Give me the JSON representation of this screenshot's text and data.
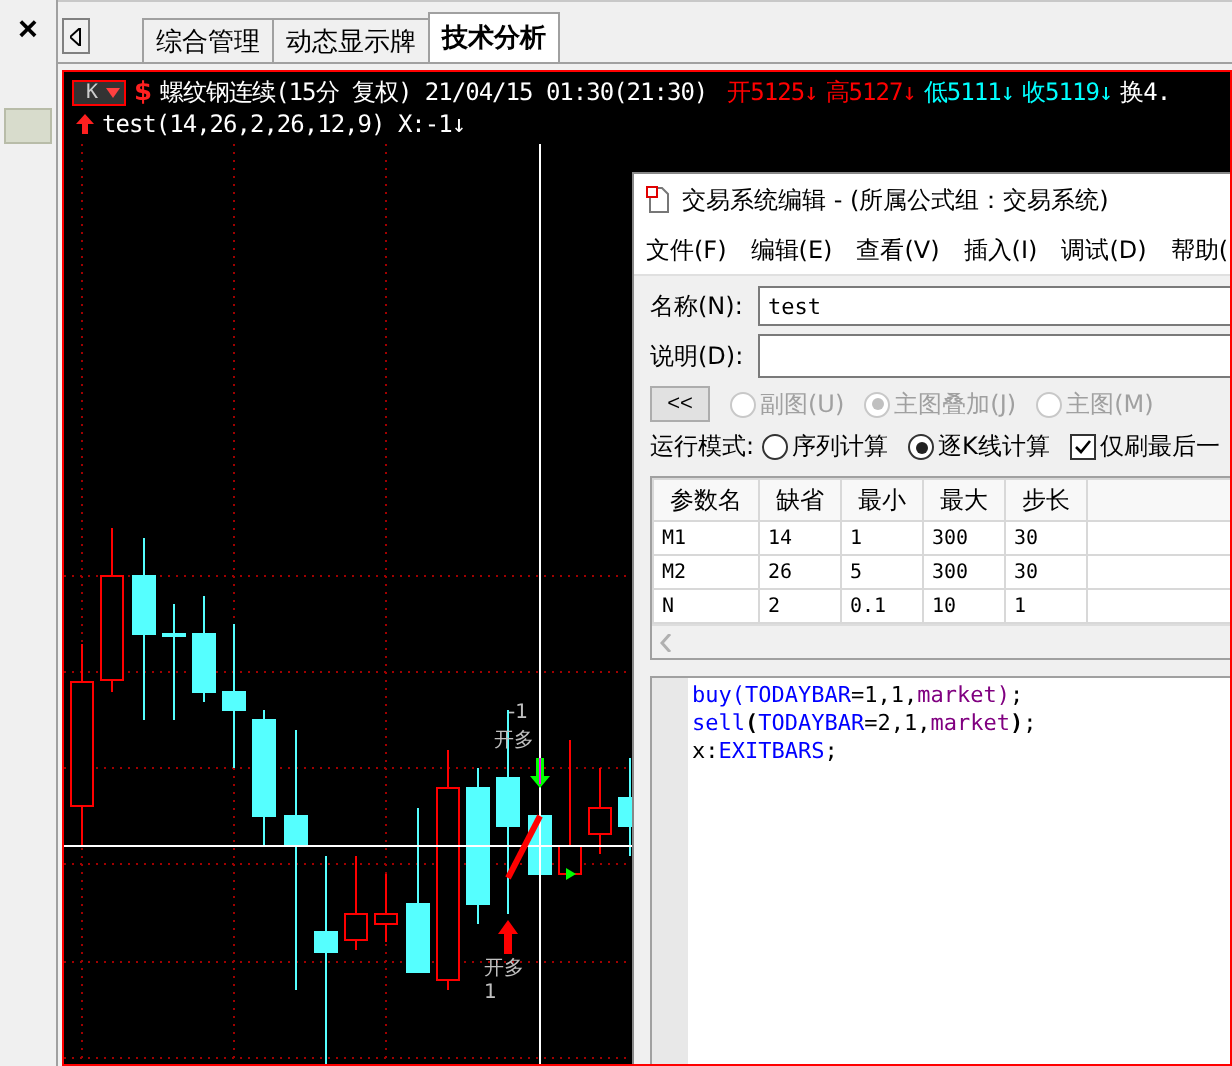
{
  "side_panel": {
    "close": "×"
  },
  "tabs": [
    {
      "label": "综合管理",
      "selected": false
    },
    {
      "label": "动态显示牌",
      "selected": false
    },
    {
      "label": "技术分析",
      "selected": true
    }
  ],
  "chart": {
    "period_button": "K",
    "symbol_mark": "$",
    "title": "螺纹钢连续(15分 复权) 21/04/15 01:30(21:30)",
    "quotes": [
      {
        "text": "开5125↓",
        "color": "#ff0000"
      },
      {
        "text": "高5127↓",
        "color": "#ff0000"
      },
      {
        "text": "低5111↓",
        "color": "#00ffff"
      },
      {
        "text": "收5119↓",
        "color": "#00ffff"
      },
      {
        "text": "换4.",
        "color": "#ffffff"
      }
    ],
    "indicator": "test(14,26,2,26,12,9) X:-1↓",
    "signal_labels": [
      {
        "text": "-1",
        "kind": "top"
      },
      {
        "text": "开多",
        "kind": "top"
      },
      {
        "text": "开多",
        "kind": "bottom"
      },
      {
        "text": "1",
        "kind": "bottom"
      }
    ]
  },
  "editor_window": {
    "title": "交易系统编辑 - (所属公式组：交易系统)",
    "menu": [
      "文件(F)",
      "编辑(E)",
      "查看(V)",
      "插入(I)",
      "调试(D)",
      "帮助("
    ],
    "name_label": "名称(N):",
    "name_value": "test",
    "description_label": "说明(D):",
    "collapse_button": "<<",
    "chart_types": [
      {
        "label": "副图(U)",
        "selected": false,
        "disabled": true
      },
      {
        "label": "主图叠加(J)",
        "selected": true,
        "disabled": true
      },
      {
        "label": "主图(M)",
        "selected": false,
        "disabled": true
      }
    ],
    "run_mode_label": "运行模式:",
    "run_modes": [
      {
        "label": "序列计算",
        "selected": false
      },
      {
        "label": "逐K线计算",
        "selected": true
      }
    ],
    "refresh_last": {
      "label": "仅刷最后一",
      "checked": true
    },
    "table": {
      "columns": [
        "参数名",
        "缺省",
        "最小",
        "最大",
        "步长"
      ],
      "rows": [
        [
          "M1",
          "14",
          "1",
          "300",
          "30"
        ],
        [
          "M2",
          "26",
          "5",
          "300",
          "30"
        ],
        [
          "N",
          "2",
          "0.1",
          "10",
          "1"
        ]
      ]
    },
    "code": [
      [
        {
          "text": "buy",
          "kind": "function"
        },
        {
          "text": "(",
          "kind": "function"
        },
        {
          "text": "TODAYBAR",
          "kind": "variable"
        },
        {
          "text": "=1,1,",
          "kind": "plain"
        },
        {
          "text": "market",
          "kind": "constant"
        },
        {
          "text": ")",
          "kind": "constant"
        },
        {
          "text": ";",
          "kind": "plain"
        }
      ],
      [
        {
          "text": "sell",
          "kind": "function"
        },
        {
          "text": "(",
          "kind": "bold"
        },
        {
          "text": "TODAYBAR",
          "kind": "variable"
        },
        {
          "text": "=2,1,",
          "kind": "plain"
        },
        {
          "text": "market",
          "kind": "constant"
        },
        {
          "text": ")",
          "kind": "bold"
        },
        {
          "text": ";",
          "kind": "plain"
        }
      ],
      [
        {
          "text": "x:",
          "kind": "plain"
        },
        {
          "text": "EXITBARS",
          "kind": "variable"
        },
        {
          "text": ";",
          "kind": "plain"
        }
      ]
    ]
  }
}
